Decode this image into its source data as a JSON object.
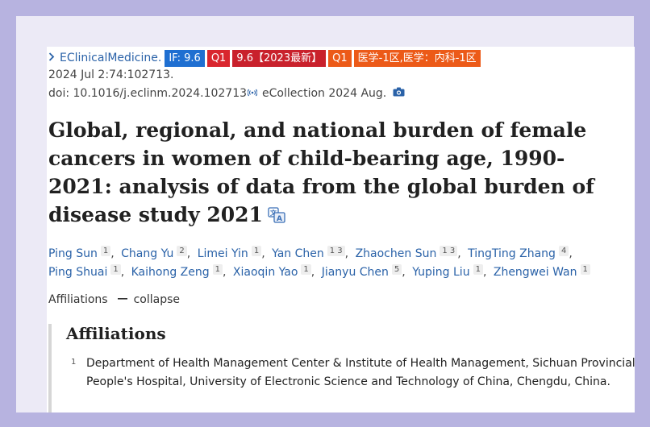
{
  "journal": {
    "name": "EClinicalMedicine.",
    "badges": {
      "if": "IF: 9.6",
      "q1a": "Q1",
      "if2023": "9.6【2023最新】",
      "q1b": "Q1",
      "cas": "医学-1区,医学：内科-1区"
    }
  },
  "citation": {
    "date": "2024 Jul 2:74:102713.",
    "doi": "doi: 10.1016/j.eclinm.2024.102713",
    "ecollection": "eCollection 2024 Aug."
  },
  "article": {
    "title": "Global, regional, and national burden of female cancers in women of child-bearing age, 1990-2021: analysis of data from the global burden of disease study 2021"
  },
  "authors": [
    {
      "name": "Ping Sun",
      "aff": "1"
    },
    {
      "name": "Chang Yu",
      "aff": "2"
    },
    {
      "name": "Limei Yin",
      "aff": "1"
    },
    {
      "name": "Yan Chen",
      "aff": "1 3"
    },
    {
      "name": "Zhaochen Sun",
      "aff": "1 3"
    },
    {
      "name": "TingTing Zhang",
      "aff": "4"
    },
    {
      "name": "Ping Shuai",
      "aff": "1"
    },
    {
      "name": "Kaihong Zeng",
      "aff": "1"
    },
    {
      "name": "Xiaoqin Yao",
      "aff": "1"
    },
    {
      "name": "Jianyu Chen",
      "aff": "5"
    },
    {
      "name": "Yuping Liu",
      "aff": "1"
    },
    {
      "name": "Zhengwei Wan",
      "aff": "1"
    }
  ],
  "affiliations": {
    "toggle_label": "Affiliations",
    "collapse_label": "collapse",
    "heading": "Affiliations",
    "items": [
      {
        "num": "1",
        "text": "Department of Health Management Center & Institute of Health Management, Sichuan Provincial People's Hospital, University of Electronic Science and Technology of China, Chengdu, China."
      }
    ]
  },
  "colors": {
    "link": "#2a62a8",
    "badge_blue": "#1f6fd1",
    "badge_red": "#c9212c",
    "badge_orange": "#ec5a18",
    "outer_bg": "#b7b3e0"
  },
  "icons": [
    "chevron-right-icon",
    "cast-icon",
    "camera-icon",
    "translate-icon"
  ]
}
